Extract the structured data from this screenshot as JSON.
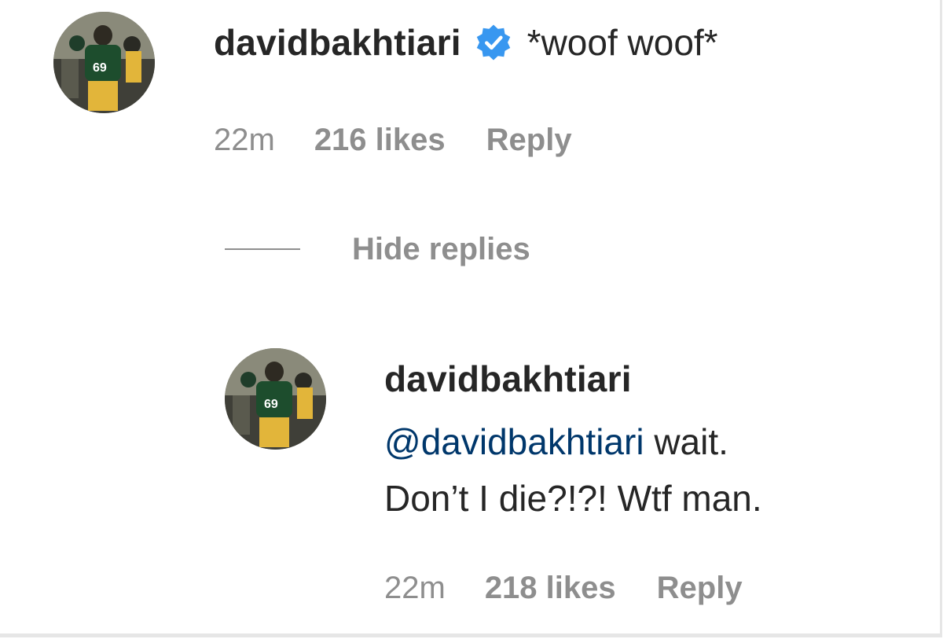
{
  "comment": {
    "avatar_icon": "profile-photo-avatar",
    "username": "davidbakhtiari",
    "verified_icon": "verified-badge-icon",
    "verified_color": "#3897f0",
    "text": "*woof woof*",
    "time": "22m",
    "likes": "216 likes",
    "reply_label": "Reply"
  },
  "replies_toggle": {
    "label": "Hide replies"
  },
  "reply": {
    "avatar_icon": "profile-photo-avatar",
    "username": "davidbakhtiari",
    "mention": "@davidbakhtiari",
    "text_line1": " wait.",
    "text_line2": "Don’t I die?!?! Wtf man.",
    "time": "22m",
    "likes": "218 likes",
    "reply_label": "Reply"
  },
  "colors": {
    "text": "#262626",
    "secondary": "#8e8e8e",
    "mention": "#00376b",
    "verified": "#3897f0"
  }
}
